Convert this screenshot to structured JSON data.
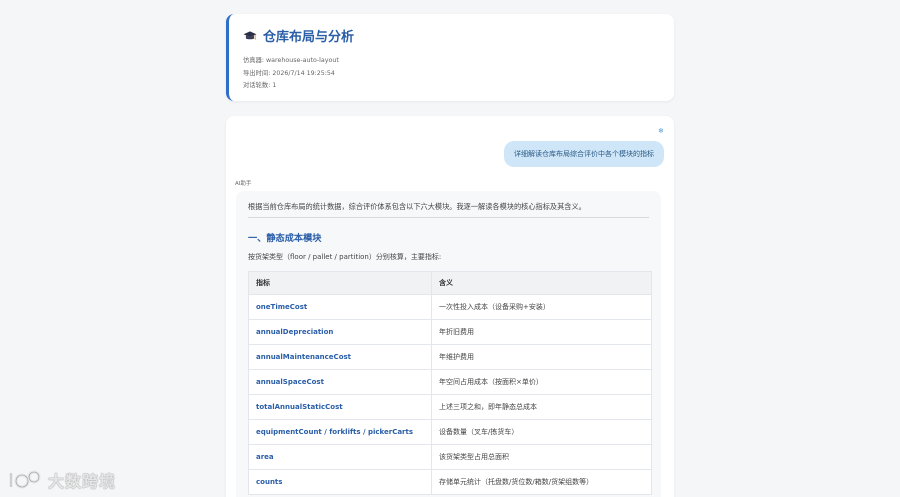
{
  "header": {
    "title": "仓库布局与分析",
    "title_icon": "graduation-cap-icon",
    "simulator_label": "仿真器:",
    "simulator_value": "warehouse-auto-layout",
    "export_label": "导出时间:",
    "export_value": "2026/7/14 19:25:54",
    "rounds_label": "对话轮数:",
    "rounds_value": "1"
  },
  "chat": {
    "user_avatar": "❄",
    "user_message": "详细解读仓库布局综合评价中各个模块的指标",
    "ai_label": "AI助手",
    "intro": "根据当前仓库布局的统计数据，综合评价体系包含以下六大模块。我逐一解读各模块的核心指标及其含义。",
    "section_title": "一、静态成本模块",
    "section_desc": "按货架类型（floor / pallet / partition）分别核算，主要指标:",
    "table": {
      "headers": [
        "指标",
        "含义"
      ],
      "rows": [
        {
          "metric": "oneTimeCost",
          "meaning": "一次性投入成本（设备采购+安装）"
        },
        {
          "metric": "annualDepreciation",
          "meaning": "年折旧费用"
        },
        {
          "metric": "annualMaintenanceCost",
          "meaning": "年维护费用"
        },
        {
          "metric": "annualSpaceCost",
          "meaning": "年空间占用成本（按面积×单价）"
        },
        {
          "metric": "totalAnnualStaticCost",
          "meaning": "上述三项之和，即年静态总成本"
        },
        {
          "metric": "equipmentCount / forklifts / pickerCarts",
          "meaning": "设备数量（叉车/拣货车）"
        },
        {
          "metric": "area",
          "meaning": "该货架类型占用总面积"
        },
        {
          "metric": "counts",
          "meaning": "存储单元统计（托盘数/货位数/箱数/货架组数等）"
        }
      ]
    }
  },
  "watermark": {
    "text": "大数跨境",
    "logo_icon": "dashuju-logo-icon"
  },
  "colors": {
    "accent": "#2f6fc8",
    "title": "#2a5ea8",
    "user_bubble": "#cfe6f8",
    "background": "#f5f6f8"
  }
}
